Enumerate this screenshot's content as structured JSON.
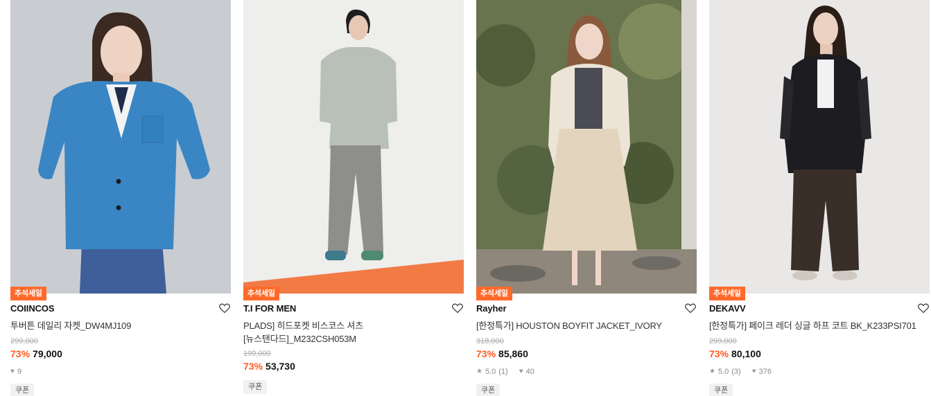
{
  "colors": {
    "sale_badge": "#ff6a2b",
    "discount": "#ff5a1f"
  },
  "products": [
    {
      "badge": "추석세일",
      "brand": "COIINCOS",
      "name_line1": "투버튼 데일리 자켓_DW4MJ109",
      "name_line2": "",
      "original_price": "299,000",
      "discount": "73%",
      "price": "79,000",
      "rating": "",
      "review_count": "",
      "likes": "9",
      "coupon": "쿠폰"
    },
    {
      "badge": "추석세일",
      "brand": "T.I FOR MEN",
      "name_line1": "PLADS] 히드포켓 비스코스 셔츠",
      "name_line2": "[뉴스탠다드]_M232CSH053M",
      "original_price": "199,000",
      "discount": "73%",
      "price": "53,730",
      "rating": "",
      "review_count": "",
      "likes": "",
      "coupon": "쿠폰"
    },
    {
      "badge": "추석세일",
      "brand": "Rayher",
      "name_line1": "[한정특가] HOUSTON BOYFIT JACKET_IVORY",
      "name_line2": "",
      "original_price": "318,000",
      "discount": "73%",
      "price": "85,860",
      "rating": "5.0",
      "review_count": "(1)",
      "likes": "40",
      "coupon": "쿠폰"
    },
    {
      "badge": "추석세일",
      "brand": "DEKAVV",
      "name_line1": "[한정특가] 페이크 레더 싱글 하프 코트 BK_K233PSI701",
      "name_line2": "",
      "original_price": "299,000",
      "discount": "73%",
      "price": "80,100",
      "rating": "5.0",
      "review_count": "(3)",
      "likes": "376",
      "coupon": "쿠폰"
    }
  ]
}
